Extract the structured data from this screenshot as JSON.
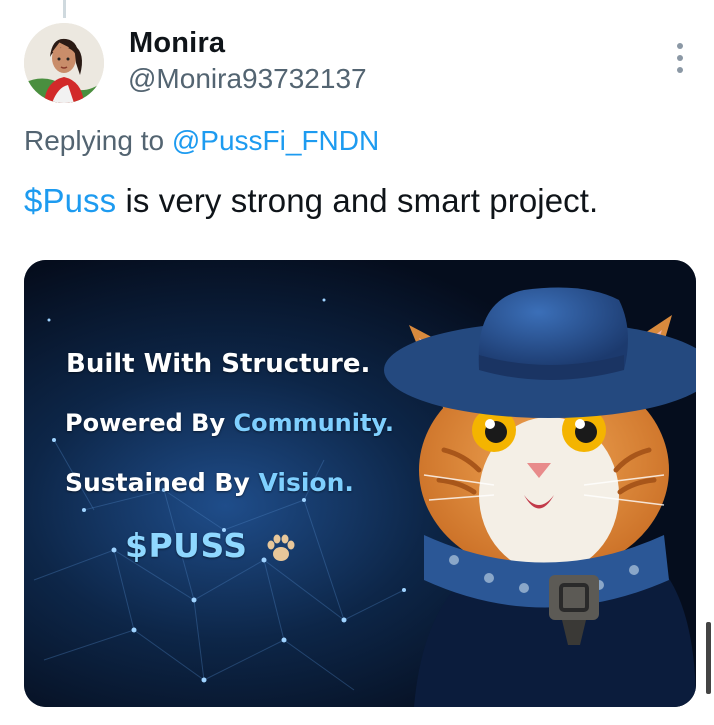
{
  "author": {
    "display_name": "Monira",
    "handle": "@Monira93732137"
  },
  "reply_context": {
    "prefix": "Replying to ",
    "mention": "@PussFi_FNDN"
  },
  "tweet": {
    "cashtag": "$Puss",
    "text": " is very strong and smart project."
  },
  "media": {
    "line1": "Built With Structure.",
    "line2_prefix": "Powered By ",
    "line2_highlight": "Community.",
    "line3_prefix": "Sustained By ",
    "line3_highlight": "Vision.",
    "ticker": "$PUSS",
    "ticker_icon": "paw-icon",
    "image_subject": "cat-with-blue-hat-illustration"
  },
  "colors": {
    "link": "#1d9bf0",
    "secondary_text": "#536471",
    "highlight": "#7fd0ff",
    "media_bg": "#061226"
  }
}
